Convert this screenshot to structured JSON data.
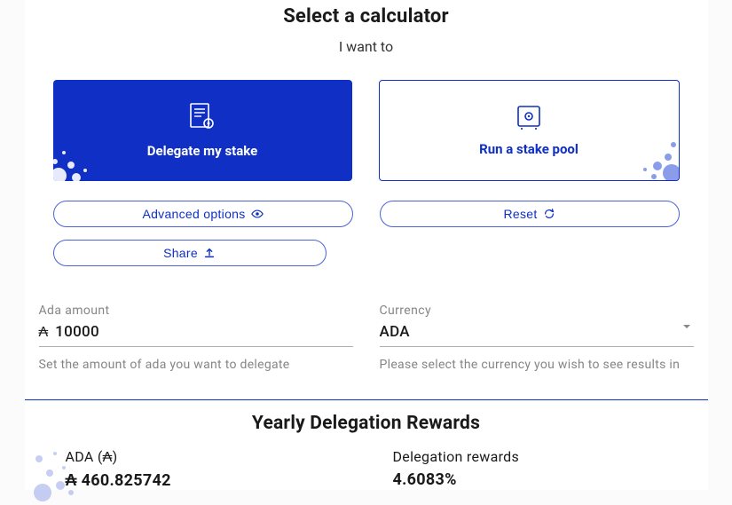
{
  "header": {
    "title": "Select a calculator",
    "subtitle": "I want to"
  },
  "cards": {
    "delegate": "Delegate my stake",
    "pool": "Run a stake pool"
  },
  "buttons": {
    "advanced": "Advanced options",
    "reset": "Reset",
    "share": "Share"
  },
  "form": {
    "amount_label": "Ada amount",
    "amount_value": "10000",
    "amount_help": "Set the amount of ada you want to delegate",
    "currency_label": "Currency",
    "currency_value": "ADA",
    "currency_help": "Please select the currency you wish to see results in"
  },
  "results": {
    "title": "Yearly Delegation Rewards",
    "ada_label": "ADA (₳)",
    "ada_value": "₳ 460.825742",
    "pct_label": "Delegation rewards",
    "pct_value": "4.6083%"
  }
}
